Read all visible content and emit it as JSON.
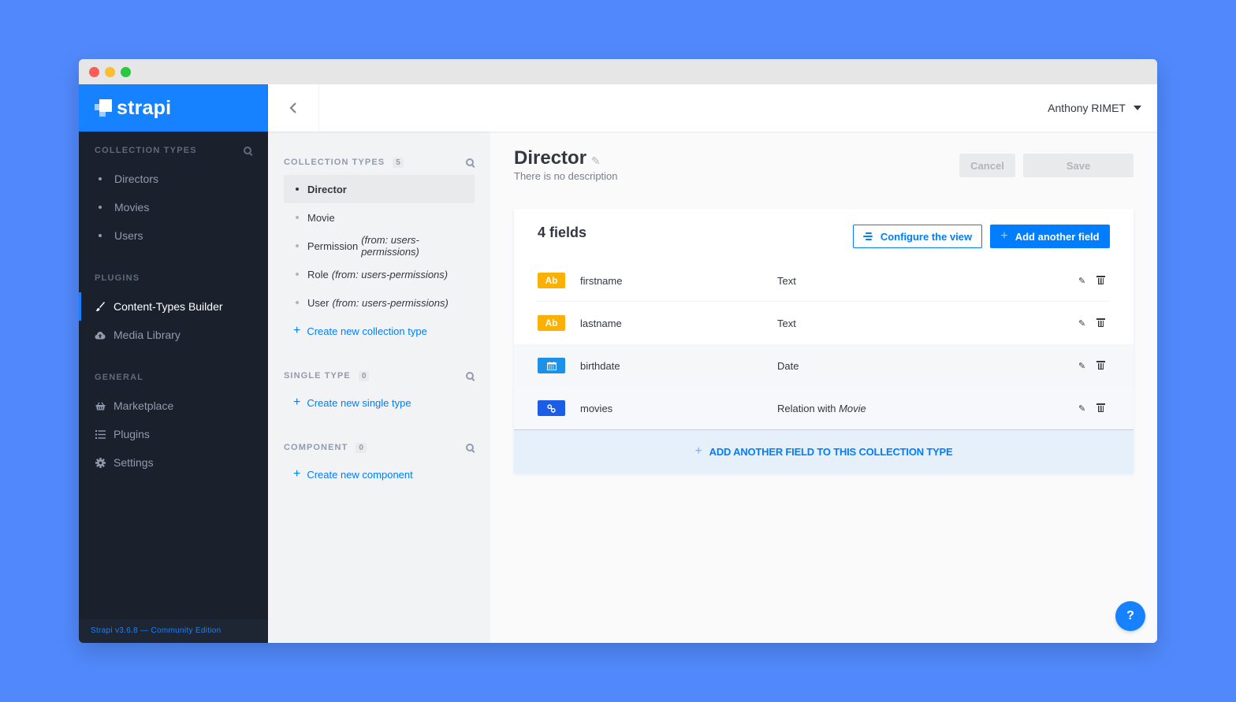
{
  "window": {
    "traffic_lights": [
      "close",
      "minimize",
      "maximize"
    ]
  },
  "brand": {
    "name": "strapi",
    "color": "#1782ff"
  },
  "left_nav": {
    "sections": [
      {
        "title": "Collection Types",
        "has_search": true,
        "items": [
          {
            "label": "Directors",
            "icon": "bullet"
          },
          {
            "label": "Movies",
            "icon": "bullet"
          },
          {
            "label": "Users",
            "icon": "bullet"
          }
        ]
      },
      {
        "title": "Plugins",
        "items": [
          {
            "label": "Content-Types Builder",
            "icon": "paint-brush-icon",
            "active": true
          },
          {
            "label": "Media Library",
            "icon": "cloud-upload-icon"
          }
        ]
      },
      {
        "title": "General",
        "items": [
          {
            "label": "Marketplace",
            "icon": "shopping-basket-icon"
          },
          {
            "label": "Plugins",
            "icon": "list-icon"
          },
          {
            "label": "Settings",
            "icon": "gear-icon"
          }
        ]
      }
    ],
    "footer": "Strapi v3.6.8 — Community Edition"
  },
  "topbar": {
    "back_icon": "chevron-left-icon",
    "user_name": "Anthony RIMET"
  },
  "ctb_menu": {
    "collection_types": {
      "title": "Collection Types",
      "count": "5",
      "items": [
        {
          "label": "Director",
          "from": "",
          "active": true
        },
        {
          "label": "Movie",
          "from": ""
        },
        {
          "label": "Permission",
          "from": "(from: users-permissions)"
        },
        {
          "label": "Role",
          "from": "(from: users-permissions)"
        },
        {
          "label": "User",
          "from": "(from: users-permissions)"
        }
      ],
      "create_label": "Create new collection type"
    },
    "single_type": {
      "title": "Single Type",
      "count": "0",
      "create_label": "Create new single type"
    },
    "component": {
      "title": "Component",
      "count": "0",
      "create_label": "Create new component"
    }
  },
  "main": {
    "title": "Director",
    "description": "There is no description",
    "cancel_label": "Cancel",
    "save_label": "Save",
    "fields_count_label": "4 fields",
    "configure_label": "Configure the view",
    "add_field_label": "Add another field",
    "fields": [
      {
        "name": "firstname",
        "type": "Text",
        "badge": "Ab",
        "badge_kind": "text",
        "badge_color": "#fab005"
      },
      {
        "name": "lastname",
        "type": "Text",
        "badge": "Ab",
        "badge_kind": "text",
        "badge_color": "#fab005"
      },
      {
        "name": "birthdate",
        "type": "Date",
        "badge": "calendar-icon",
        "badge_kind": "date",
        "badge_color": "#1c91e7"
      },
      {
        "name": "movies",
        "type": "Relation with",
        "type_target": "Movie",
        "badge": "link-icon",
        "badge_kind": "relation",
        "badge_color": "#1c5de7"
      }
    ],
    "add_footer_label": "Add another field to this collection type",
    "help_label": "?"
  }
}
